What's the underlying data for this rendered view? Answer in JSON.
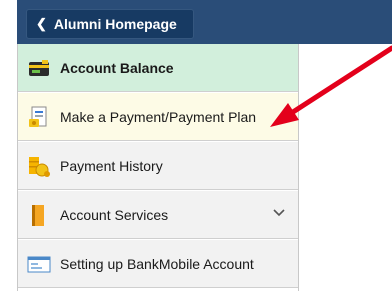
{
  "header": {
    "back_label": "Alumni Homepage"
  },
  "menu": {
    "items": [
      {
        "label": "Account Balance",
        "icon": "wallet-card-icon"
      },
      {
        "label": "Make a Payment/Payment Plan",
        "icon": "payment-document-icon"
      },
      {
        "label": "Payment History",
        "icon": "coins-icon"
      },
      {
        "label": "Account Services",
        "icon": "folder-icon"
      },
      {
        "label": "Setting up BankMobile Account",
        "icon": "bank-window-icon"
      }
    ]
  },
  "colors": {
    "topbar": "#2a4d78",
    "active_item": "#d2efdc",
    "highlight_item": "#fdfbe6",
    "annotation_arrow": "#e3001b"
  }
}
